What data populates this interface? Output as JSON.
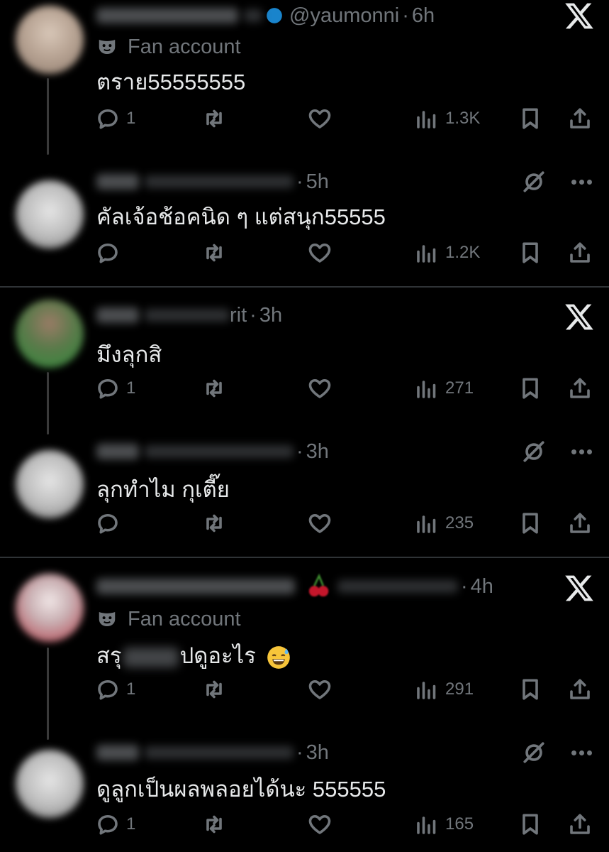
{
  "tweets": [
    {
      "handle": "@yaumonni",
      "time": "6h",
      "label": "Fan account",
      "text": "ตราย55555555",
      "replies": "1",
      "views": "1.3K",
      "type": "x-post"
    },
    {
      "handle": "",
      "time": "5h",
      "text": "คัลเจ้อช้อคนิด ๆ แต่สนุก55555",
      "replies": "",
      "views": "1.2K",
      "type": "reply"
    },
    {
      "handle": "rit",
      "time": "3h",
      "text": "มึงลุกสิ",
      "replies": "1",
      "views": "271",
      "type": "x-post"
    },
    {
      "handle": "",
      "time": "3h",
      "text": "ลุกทำไม กุเตี๊ย",
      "replies": "",
      "views": "235",
      "type": "reply"
    },
    {
      "handle": "",
      "time": "4h",
      "label": "Fan account",
      "text_a": "สรุ",
      "text_b": "ปดูอะไร",
      "replies": "1",
      "views": "291",
      "type": "x-post"
    },
    {
      "handle": "",
      "time": "3h",
      "text": "ดูลูกเป็นผลพลอยได้นะ 555555",
      "replies": "1",
      "views": "165",
      "type": "reply"
    }
  ],
  "separator": "·",
  "icons": {
    "reply": "reply-icon",
    "retweet": "retweet-icon",
    "like": "heart-icon",
    "views": "views-icon",
    "bookmark": "bookmark-icon",
    "share": "share-icon",
    "x_logo": "x-logo-icon",
    "grok": "grok-icon",
    "more": "more-icon",
    "label": "fan-mask-icon",
    "emoji": "sweat-smile-emoji"
  },
  "colors": {
    "background": "#000000",
    "text": "#e7e9ea",
    "muted": "#71767b",
    "verified": "#1d9bf0"
  }
}
